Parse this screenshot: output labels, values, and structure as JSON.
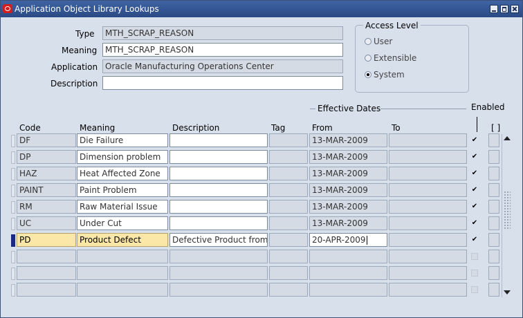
{
  "window": {
    "title": "Application Object Library Lookups"
  },
  "header": {
    "type_label": "Type",
    "type_value": "MTH_SCRAP_REASON",
    "meaning_label": "Meaning",
    "meaning_value": "MTH_SCRAP_REASON",
    "application_label": "Application",
    "application_value": "Oracle Manufacturing Operations Center",
    "description_label": "Description",
    "description_value": ""
  },
  "access_level": {
    "title": "Access Level",
    "user_label": "User",
    "extensible_label": "Extensible",
    "system_label": "System",
    "selected": "System"
  },
  "table": {
    "effective_dates_label": "Effective Dates",
    "enabled_label": "Enabled",
    "columns": {
      "code": "Code",
      "meaning": "Meaning",
      "description": "Description",
      "tag": "Tag",
      "from": "From",
      "to": "To",
      "flex": "[ ]"
    },
    "rows": [
      {
        "code": "DF",
        "meaning": "Die Failure",
        "description": "",
        "tag": "",
        "from": "13-MAR-2009",
        "to": "",
        "enabled": true
      },
      {
        "code": "DP",
        "meaning": "Dimension problem",
        "description": "",
        "tag": "",
        "from": "13-MAR-2009",
        "to": "",
        "enabled": true
      },
      {
        "code": "HAZ",
        "meaning": "Heat Affected Zone",
        "description": "",
        "tag": "",
        "from": "13-MAR-2009",
        "to": "",
        "enabled": true
      },
      {
        "code": "PAINT",
        "meaning": "Paint Problem",
        "description": "",
        "tag": "",
        "from": "13-MAR-2009",
        "to": "",
        "enabled": true
      },
      {
        "code": "RM",
        "meaning": "Raw Material Issue",
        "description": "",
        "tag": "",
        "from": "13-MAR-2009",
        "to": "",
        "enabled": true
      },
      {
        "code": "UC",
        "meaning": "Under Cut",
        "description": "",
        "tag": "",
        "from": "13-MAR-2009",
        "to": "",
        "enabled": true
      },
      {
        "code": "PD",
        "meaning": "Product Defect",
        "description": "Defective Product from S",
        "tag": "",
        "from": "20-APR-2009",
        "to": "",
        "enabled": true,
        "current": true
      },
      {
        "code": "",
        "meaning": "",
        "description": "",
        "tag": "",
        "from": "",
        "to": "",
        "enabled": false
      },
      {
        "code": "",
        "meaning": "",
        "description": "",
        "tag": "",
        "from": "",
        "to": "",
        "enabled": false
      },
      {
        "code": "",
        "meaning": "",
        "description": "",
        "tag": "",
        "from": "",
        "to": "",
        "enabled": false
      }
    ]
  }
}
